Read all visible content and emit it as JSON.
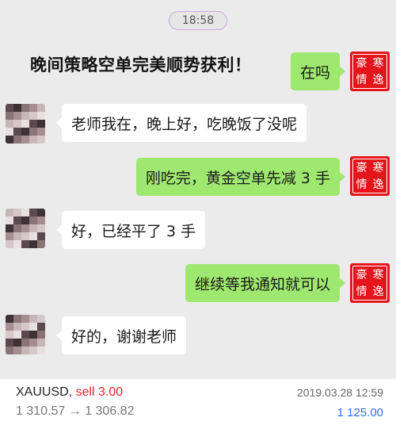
{
  "chat": {
    "timestamp": "18:58",
    "headline": "晚间策略空单完美顺势获利！",
    "seal_chars": [
      "豪",
      "寒",
      "情",
      "逸"
    ],
    "messages": [
      {
        "dir": "out",
        "text": "在吗"
      },
      {
        "dir": "in",
        "text": "老师我在，晚上好，吃晚饭了没呢"
      },
      {
        "dir": "out",
        "text": "刚吃完，黄金空单先减 3 手"
      },
      {
        "dir": "in",
        "text": "好，已经平了 3 手"
      },
      {
        "dir": "out",
        "text": "继续等我通知就可以"
      },
      {
        "dir": "in",
        "text": "好的，谢谢老师"
      }
    ]
  },
  "trade": {
    "symbol": "XAUUSD,",
    "side": "sell 3.00",
    "datetime": "2019.03.28 12:59",
    "open_price": "1 310.57",
    "arrow": "→",
    "close_price": "1 306.82",
    "profit": "1 125.00"
  },
  "colors": {
    "outgoing_bubble": "#9fe870",
    "incoming_bubble": "#ffffff",
    "seal_red": "#e4151b",
    "sell_red": "#e0262c",
    "profit_blue": "#2f6fe0"
  }
}
